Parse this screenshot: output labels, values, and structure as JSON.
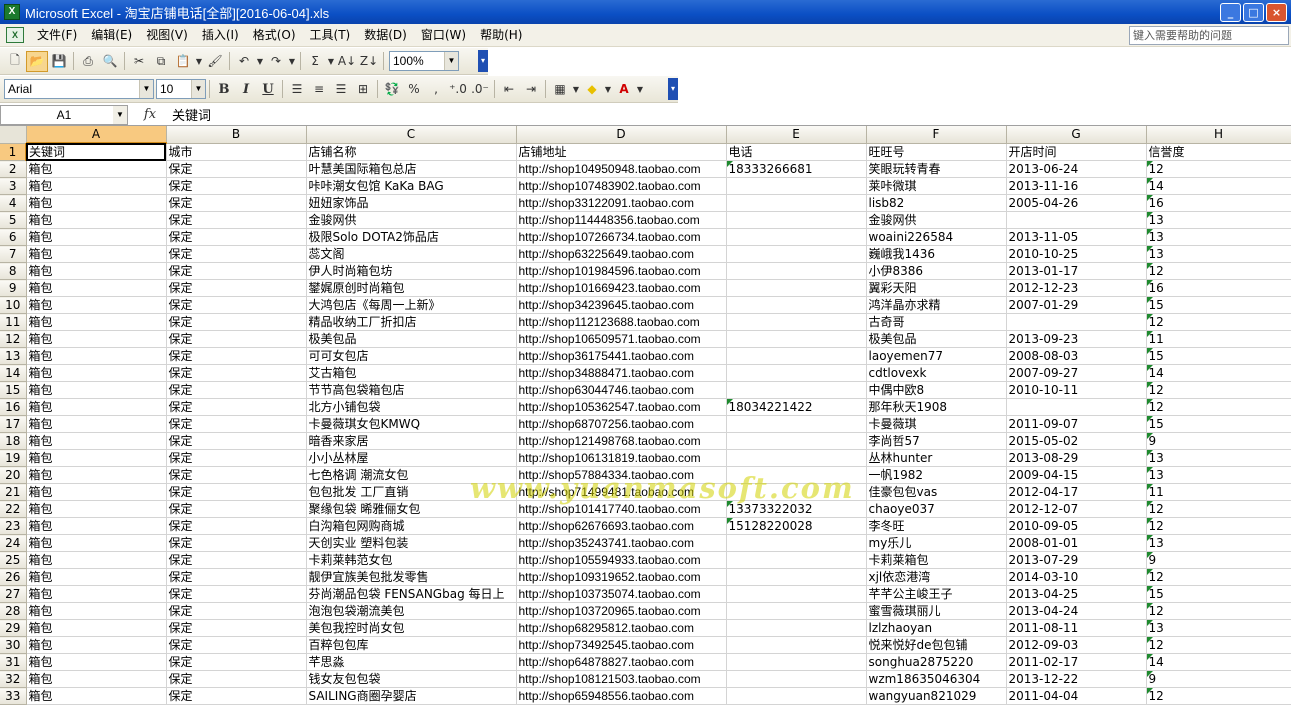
{
  "window": {
    "title": "Microsoft Excel - 淘宝店铺电话[全部][2016-06-04].xls"
  },
  "menu": {
    "items": [
      "文件(F)",
      "编辑(E)",
      "视图(V)",
      "插入(I)",
      "格式(O)",
      "工具(T)",
      "数据(D)",
      "窗口(W)",
      "帮助(H)"
    ],
    "help_placeholder": "键入需要帮助的问题"
  },
  "toolbar": {
    "zoom": "100%",
    "font_name": "Arial",
    "font_size": "10",
    "bold": "B",
    "italic": "I",
    "underline": "U",
    "sigma": "Σ",
    "percent": "%"
  },
  "formula": {
    "cell_ref": "A1",
    "fx": "fx",
    "value": "关键词"
  },
  "watermark": "www.yuanmasoft.com",
  "sheet": {
    "columns": [
      "A",
      "B",
      "C",
      "D",
      "E",
      "F",
      "G",
      "H"
    ],
    "rows": [
      [
        "关键词",
        "城市",
        "店铺名称",
        "店铺地址",
        "电话",
        "旺旺号",
        "开店时间",
        "信誉度"
      ],
      [
        "箱包",
        "保定",
        "叶慧美国际箱包总店",
        "http://shop104950948.taobao.com",
        "18333266681",
        "笑眼玩转青春",
        "2013-06-24",
        "12"
      ],
      [
        "箱包",
        "保定",
        "咔咔潮女包馆 KaKa BAG",
        "http://shop107483902.taobao.com",
        "",
        "莱咔微琪",
        "2013-11-16",
        "14"
      ],
      [
        "箱包",
        "保定",
        "妞妞家饰品",
        "http://shop33122091.taobao.com",
        "",
        "lisb82",
        "2005-04-26",
        "16"
      ],
      [
        "箱包",
        "保定",
        "金骏网供",
        "http://shop114448356.taobao.com",
        "",
        "金骏网供",
        "",
        "13"
      ],
      [
        "箱包",
        "保定",
        "极限Solo DOTA2饰品店",
        "http://shop107266734.taobao.com",
        "",
        "woaini226584",
        "2013-11-05",
        "13"
      ],
      [
        "箱包",
        "保定",
        "蕊文阁",
        "http://shop63225649.taobao.com",
        "",
        "巍峨我1436",
        "2010-10-25",
        "13"
      ],
      [
        "箱包",
        "保定",
        "伊人时尚箱包坊",
        "http://shop101984596.taobao.com",
        "",
        "小伊8386",
        "2013-01-17",
        "12"
      ],
      [
        "箱包",
        "保定",
        "鐢娓原创时尚箱包",
        "http://shop101669423.taobao.com",
        "",
        "翼彩天阳",
        "2012-12-23",
        "16"
      ],
      [
        "箱包",
        "保定",
        "大鸿包店《每周一上新》",
        "http://shop34239645.taobao.com",
        "",
        "鸿洋晶亦求精",
        "2007-01-29",
        "15"
      ],
      [
        "箱包",
        "保定",
        "精品收纳工厂折扣店",
        "http://shop112123688.taobao.com",
        "",
        "古奇哥",
        "",
        "12"
      ],
      [
        "箱包",
        "保定",
        "极美包品",
        "http://shop106509571.taobao.com",
        "",
        "极美包品",
        "2013-09-23",
        "11"
      ],
      [
        "箱包",
        "保定",
        "可可女包店",
        "http://shop36175441.taobao.com",
        "",
        "laoyemen77",
        "2008-08-03",
        "15"
      ],
      [
        "箱包",
        "保定",
        "艾古箱包",
        "http://shop34888471.taobao.com",
        "",
        "cdtlovexk",
        "2007-09-27",
        "14"
      ],
      [
        "箱包",
        "保定",
        "节节高包袋箱包店",
        "http://shop63044746.taobao.com",
        "",
        "中偶中欧8",
        "2010-10-11",
        "12"
      ],
      [
        "箱包",
        "保定",
        "北方小铺包袋",
        "http://shop105362547.taobao.com",
        "18034221422",
        "那年秋天1908",
        "",
        "12"
      ],
      [
        "箱包",
        "保定",
        "卡曼薇琪女包KMWQ",
        "http://shop68707256.taobao.com",
        "",
        "卡曼薇琪",
        "2011-09-07",
        "15"
      ],
      [
        "箱包",
        "保定",
        "暗香来家居",
        "http://shop121498768.taobao.com",
        "",
        "李尚哲57",
        "2015-05-02",
        "9"
      ],
      [
        "箱包",
        "保定",
        "小小丛林屋",
        "http://shop106131819.taobao.com",
        "",
        "丛林hunter",
        "2013-08-29",
        "13"
      ],
      [
        "箱包",
        "保定",
        "七色格调 潮流女包",
        "http://shop57884334.taobao.com",
        "",
        "一帆1982",
        "2009-04-15",
        "13"
      ],
      [
        "箱包",
        "保定",
        "包包批发 工厂直销",
        "http://shop71499481.taobao.com",
        "",
        "佳豪包包vas",
        "2012-04-17",
        "11"
      ],
      [
        "箱包",
        "保定",
        "聚缘包袋 晞雅俪女包",
        "http://shop101417740.taobao.com",
        "13373322032",
        "chaoye037",
        "2012-12-07",
        "12"
      ],
      [
        "箱包",
        "保定",
        "白沟箱包网购商城",
        "http://shop62676693.taobao.com",
        "15128220028",
        "李冬旺",
        "2010-09-05",
        "12"
      ],
      [
        "箱包",
        "保定",
        "天创实业 塑料包装",
        "http://shop35243741.taobao.com",
        "",
        "my乐儿",
        "2008-01-01",
        "13"
      ],
      [
        "箱包",
        "保定",
        "卡莉莱韩范女包",
        "http://shop105594933.taobao.com",
        "",
        "卡莉莱箱包",
        "2013-07-29",
        "9"
      ],
      [
        "箱包",
        "保定",
        "靓伊宜族美包批发零售",
        "http://shop109319652.taobao.com",
        "",
        "xjl依恋港湾",
        "2014-03-10",
        "12"
      ],
      [
        "箱包",
        "保定",
        "芬尚潮品包袋 FENSANGbag 每日上",
        "http://shop103735074.taobao.com",
        "",
        "芊芊公主峻王子",
        "2013-04-25",
        "15"
      ],
      [
        "箱包",
        "保定",
        "泡泡包袋潮流美包",
        "http://shop103720965.taobao.com",
        "",
        "蜜雪薇琪丽儿",
        "2013-04-24",
        "12"
      ],
      [
        "箱包",
        "保定",
        "美包我控时尚女包",
        "http://shop68295812.taobao.com",
        "",
        "lzlzhaoyan",
        "2011-08-11",
        "13"
      ],
      [
        "箱包",
        "保定",
        "百粹包包库",
        "http://shop73492545.taobao.com",
        "",
        "悦来悦好de包包铺",
        "2012-09-03",
        "12"
      ],
      [
        "箱包",
        "保定",
        "芊思淼",
        "http://shop64878827.taobao.com",
        "",
        "songhua2875220",
        "2011-02-17",
        "14"
      ],
      [
        "箱包",
        "保定",
        "钱女友包包袋",
        "http://shop108121503.taobao.com",
        "",
        "wzm18635046304",
        "2013-12-22",
        "9"
      ],
      [
        "箱包",
        "保定",
        "SAILING商圈孕婴店",
        "http://shop65948556.taobao.com",
        "",
        "wangyuan821029",
        "2011-04-04",
        "12"
      ]
    ]
  }
}
